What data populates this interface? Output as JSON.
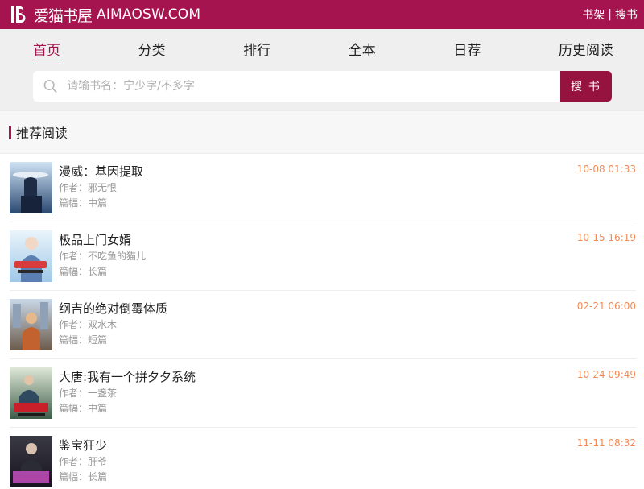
{
  "header": {
    "brand_cn": "爱猫书屋",
    "brand_domain": "AIMAOSW.COM",
    "links": [
      "书架",
      "搜书"
    ],
    "link_sep": "|",
    "brand_color": "#a5144e"
  },
  "nav": {
    "items": [
      "首页",
      "分类",
      "排行",
      "全本",
      "日荐",
      "历史阅读"
    ],
    "active_index": 0
  },
  "search": {
    "placeholder": "请输书名：宁少字/不多字",
    "button_label": "搜 书"
  },
  "section": {
    "title": "推荐阅读"
  },
  "books": [
    {
      "title": "漫威：基因提取",
      "author": "作者：邪无恨",
      "length": "篇幅：中篇",
      "date": "10-08 01:33"
    },
    {
      "title": "极品上门女婿",
      "author": "作者：不吃鱼的猫儿",
      "length": "篇幅：长篇",
      "date": "10-15 16:19"
    },
    {
      "title": "纲吉的绝对倒霉体质",
      "author": "作者：双水木",
      "length": "篇幅：短篇",
      "date": "02-21 06:00"
    },
    {
      "title": "大唐:我有一个拼夕夕系统",
      "author": "作者：一盏茶",
      "length": "篇幅：中篇",
      "date": "10-24 09:49"
    },
    {
      "title": "鉴宝狂少",
      "author": "作者：肝爷",
      "length": "篇幅：长篇",
      "date": "11-11 08:32"
    }
  ],
  "colors": {
    "accent": "#a5144e",
    "date": "#f08b57"
  }
}
